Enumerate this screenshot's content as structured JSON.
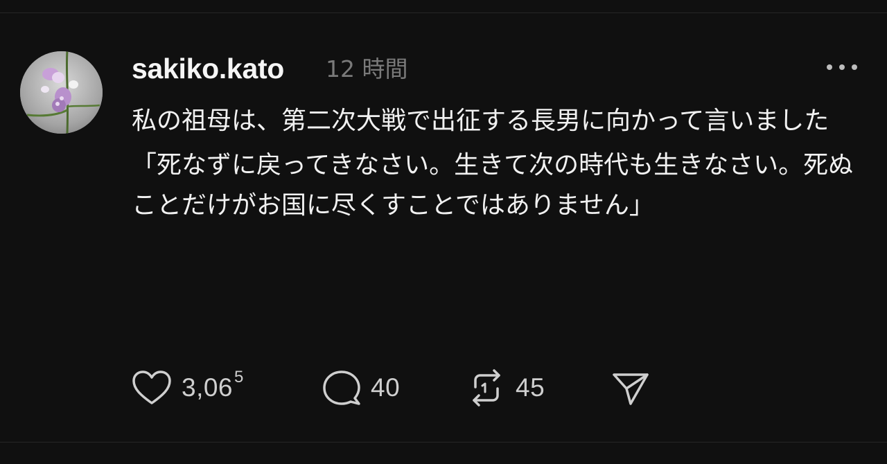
{
  "post": {
    "author": "sakiko.kato",
    "timestamp": "12 時間",
    "paragraph_1": "私の祖母は、第二次大戦で出征する長男に向かって言いました",
    "paragraph_2": "「死なずに戻ってきなさい。生きて次の時代も生きなさい。死ぬことだけがお国に尽くすことではありません」"
  },
  "actions": {
    "like_count_main": "3,06",
    "like_count_sup": "5",
    "reply_count": "40",
    "repost_count": "45"
  },
  "icons": {
    "avatar": "avatar-image",
    "more": "more-horizontal-icon",
    "like": "heart-icon",
    "reply": "speech-bubble-icon",
    "repost": "repost-icon",
    "share": "send-icon"
  },
  "colors": {
    "background": "#101010",
    "text": "#f3f3f3",
    "muted": "#7a7a7a",
    "icon": "#cfcfcf"
  }
}
